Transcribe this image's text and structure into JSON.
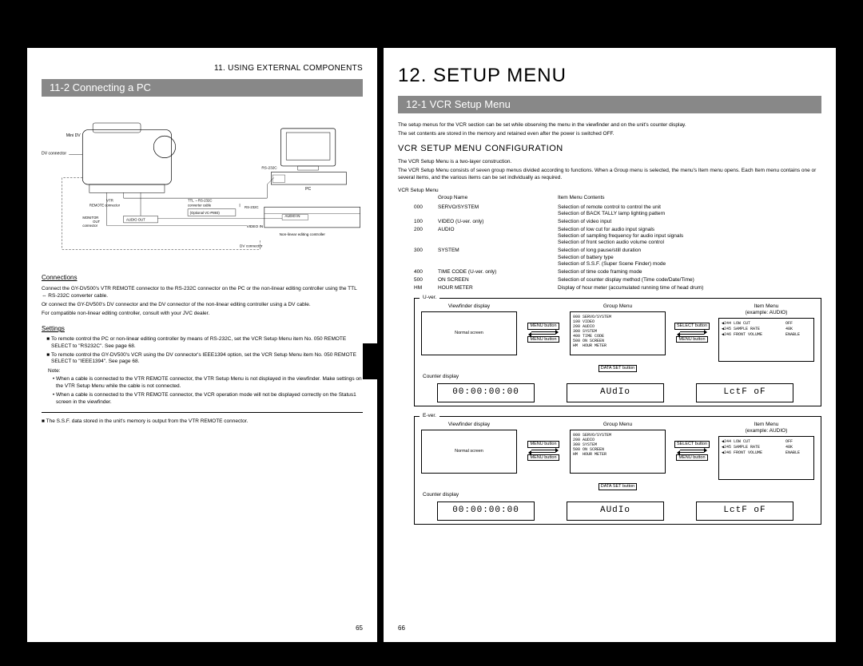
{
  "left": {
    "header": "11. USING EXTERNAL COMPONENTS",
    "section": "11-2  Connecting a PC",
    "diagram": {
      "labels": {
        "dv_connector": "DV connector",
        "vtr_remote": "VTR\nREMOTE connector",
        "monitor_out": "MONITOR\nOUT\nconnector",
        "audio_out": "AUDIO OUT",
        "ttl_rs232c": "TTL ⇔RS-232C\nconverter cable",
        "optional": "(Optional VC-P893)",
        "rs232c": "RS-232C",
        "pc": "PC",
        "audio_in": "AUDIO IN",
        "video_in": "VIDEO IN",
        "nonlinear": "Non-linear editing controller",
        "dv_connector2": "DV connector",
        "minidv": "MiniDV"
      }
    },
    "connections_h": "Connections",
    "connections_body": [
      "Connect the GY-DV500's VTR REMOTE connector to the RS-232C connector on the PC or the non-linear editing controller using the TTL ⇔ RS-232C converter cable.",
      "Or connect the GY-DV500's DV connector and the DV connector of the non-linear editing controller using a DV cable.",
      "For compatible non-linear editing controller, consult with your JVC dealer."
    ],
    "settings_h": "Settings",
    "settings_bullets": [
      "To remote control the PC or non-linear editing controller by means of RS-232C, set the VCR Setup Menu item No. 050 REMOTE SELECT to \"RS232C\".     See page 68.",
      "To remote control the GY-DV500's VCR using the DV connector's IEEE1394 option, set the VCR Setup Menu item No. 050 REMOTE SELECT to \"IEEE1394\".     See page 68."
    ],
    "note_h": "Note:",
    "note_bullets": [
      "When a cable is connected to the VTR REMOTE connector, the VTR Setup Menu is not displayed in the viewfinder. Make settings on the VTR Setup Menu while the cable is not connected.",
      "When a cable is connected to the VTR REMOTE connector, the VCR operation mode will not be displayed correctly on the Status1 screen in the viewfinder."
    ],
    "footnote": "■ The S.S.F. data stored in the unit's memory is output from the VTR REMOTE connector.",
    "pagenum": "65"
  },
  "right": {
    "chapter": "12. SETUP MENU",
    "section": "12-1  VCR Setup Menu",
    "intro": [
      "The setup menus for the VCR section can be set while observing the menu in the viewfinder and on the unit's counter display.",
      "The set contents are stored in the memory and retained even after the power is switched OFF."
    ],
    "config_h": "VCR SETUP MENU CONFIGURATION",
    "config_body": [
      "The VCR Setup Menu is a two-layer construction.",
      "The VCR Setup Menu consists of seven group menus divided according to functions. When a Group menu is selected, the menu's Item menu opens. Each Item menu contains one or several items, and the various items can be set individually as required."
    ],
    "tree_header": "VCR Setup Menu",
    "col_group": "Group Name",
    "col_item": "Item Menu Contents",
    "groups": [
      {
        "code": "000",
        "name": "SERVO/SYSTEM",
        "desc": [
          "Selection of remote control to control the unit",
          "Selection of BACK TALLY lamp lighting pattern"
        ]
      },
      {
        "code": "100",
        "name": "VIDEO (U-ver. only)",
        "desc": [
          "Selection of video input"
        ]
      },
      {
        "code": "200",
        "name": "AUDIO",
        "desc": [
          "Selection of low cut for audio input signals",
          "Selection of sampling frequency for audio input signals",
          "Selection of front section audio volume control"
        ]
      },
      {
        "code": "300",
        "name": "SYSTEM",
        "desc": [
          "Selection of long pause/still duration",
          "Selection of battery type",
          "Selection of S.S.F. (Super Scene Finder) mode"
        ]
      },
      {
        "code": "400",
        "name": "TIME CODE (U-ver. only)",
        "desc": [
          "Selection of time code framing mode"
        ]
      },
      {
        "code": "500",
        "name": "ON SCREEN",
        "desc": [
          "Selection of counter display method (Time code/Date/Time)"
        ]
      },
      {
        "code": "HM",
        "name": "HOUR METER",
        "desc": [
          "Display of hour meter (accumulated running time of head drum)"
        ]
      }
    ],
    "uver_label": "U-ver.",
    "ever_label": "E-ver.",
    "viewfinder_h": "Viewfinder display",
    "groupmenu_h": "Group Menu",
    "itemmenu_h": "Item Menu",
    "itemmenu_sub": "(example: AUDIO)",
    "normal_screen": "Normal screen",
    "menu_button": "MENU button",
    "select_button": "SELECT button",
    "dataset_button": "DATA SET button",
    "counter_display_h": "Counter display",
    "menu_list_u": "000 SERVO/SYSTEM\n100 VIDEO\n200 AUDIO\n300 SYSTEM\n400 TIME CODE\n500 ON SCREEN\nHM  HOUR METER",
    "menu_list_e": "000 SERVO/SYSTEM\n200 AUDIO\n300 SYSTEM\n500 ON SCREEN\nHM  HOUR METER",
    "item_lines": [
      {
        "k": "244 LOW CUT",
        "v": "OFF"
      },
      {
        "k": "245 SAMPLE RATE",
        "v": "48K"
      },
      {
        "k": "246 FRONT VOLUME",
        "v": "ENABLE"
      }
    ],
    "counter_time": "00:00:00:00",
    "counter_audio": "AUdIo",
    "counter_lctf": "LctF oF",
    "pagenum": "66"
  }
}
